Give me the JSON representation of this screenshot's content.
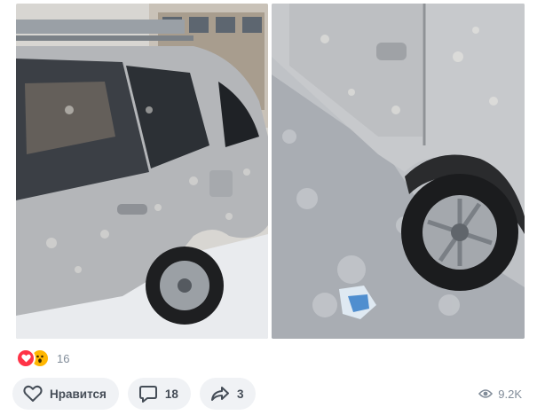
{
  "post": {
    "photos": [
      {
        "alt": "",
        "color": "#b8babd"
      },
      {
        "alt": "",
        "color": "#c4c6c8"
      }
    ],
    "reactions": {
      "icons": [
        "heart-icon",
        "wow-face-icon"
      ],
      "count": "16"
    },
    "actions": {
      "like_label": "Нравится",
      "comments_count": "18",
      "shares_count": "3"
    },
    "views_count": "9.2K"
  },
  "colors": {
    "pill_bg": "#f0f2f5",
    "muted_text": "#818c99",
    "heart": "#ff3347",
    "wow": "#ffb600"
  }
}
